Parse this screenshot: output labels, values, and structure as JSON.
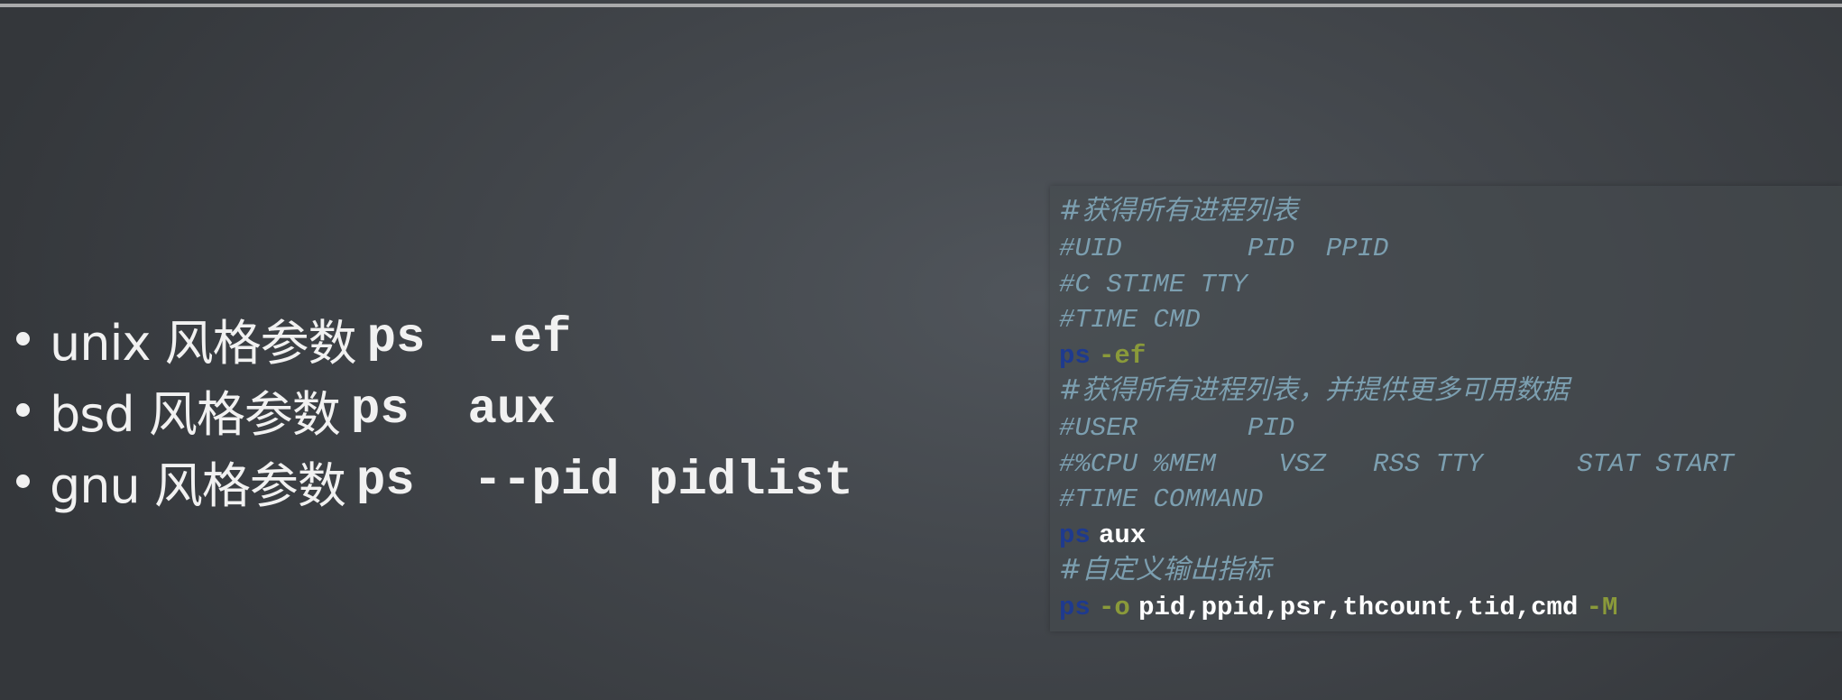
{
  "bullets": [
    {
      "text": "unix 风格参数",
      "code": "ps  -ef"
    },
    {
      "text": "bsd 风格参数",
      "code": "ps  aux"
    },
    {
      "text": "gnu 风格参数",
      "code": "ps  --pid pidlist"
    }
  ],
  "code": {
    "c1": "#获得所有进程列表",
    "c2": "#UID        PID  PPID",
    "c3": "#C STIME TTY",
    "c4": "#TIME CMD",
    "l5_cmd": "ps",
    "l5_opt": "-ef",
    "c6": "#获得所有进程列表，并提供更多可用数据",
    "c7": "#USER       PID",
    "c8": "#%CPU %MEM    VSZ   RSS TTY      STAT START",
    "c9": "#TIME COMMAND",
    "l10_cmd": "ps",
    "l10_arg": "aux",
    "c11": "#自定义输出指标",
    "l12_cmd": "ps",
    "l12_opt": "-o",
    "l12_arg": "pid,ppid,psr,thcount,tid,cmd",
    "l12_opt2": "-M"
  },
  "colors": {
    "background": "#43474c",
    "comment": "#7c9fb0",
    "keyword": "#1e3a8f",
    "option": "#8a9a3a",
    "argument": "#ffffff"
  }
}
